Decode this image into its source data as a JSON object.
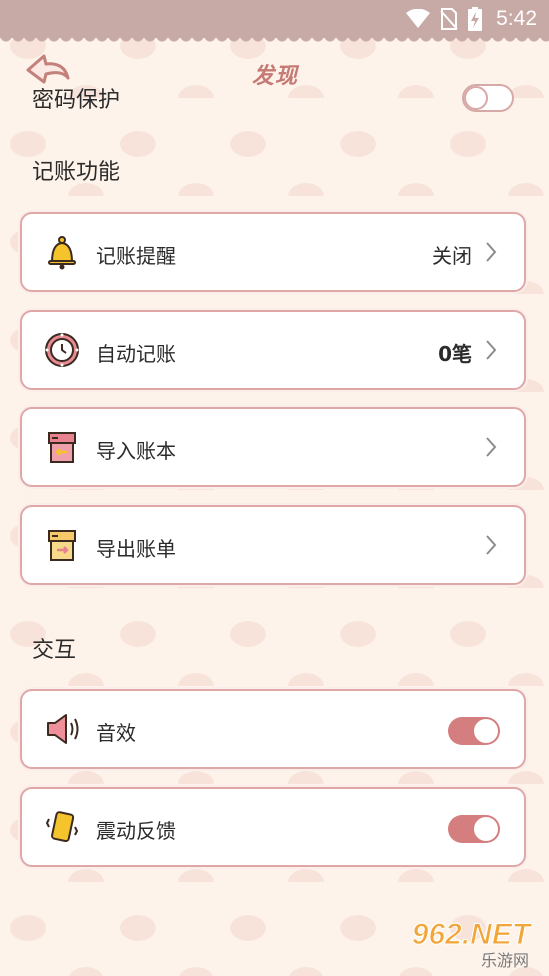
{
  "status_bar": {
    "time": "5:42",
    "icons": [
      "wifi-icon",
      "no-sim-icon",
      "battery-charging-icon"
    ],
    "background_color": "#c7a9a6"
  },
  "header": {
    "title": "发现",
    "back_icon": "back-arrow-icon",
    "title_color": "#c67a74"
  },
  "password_row": {
    "label": "密码保护",
    "enabled": false
  },
  "accounting": {
    "section_title": "记账功能",
    "items": [
      {
        "icon": "bell-icon",
        "label": "记账提醒",
        "value": "关闭",
        "bold": false
      },
      {
        "icon": "clock-icon",
        "label": "自动记账",
        "value": "0笔",
        "bold": true
      },
      {
        "icon": "import-box-icon",
        "label": "导入账本",
        "value": "",
        "bold": false
      },
      {
        "icon": "export-box-icon",
        "label": "导出账单",
        "value": "",
        "bold": false
      }
    ]
  },
  "interaction": {
    "section_title": "交互",
    "items": [
      {
        "icon": "speaker-icon",
        "label": "音效",
        "enabled": true
      },
      {
        "icon": "phone-vibrate-icon",
        "label": "震动反馈",
        "enabled": true
      }
    ]
  },
  "watermark": {
    "text": "962.NET",
    "subtext": "乐游网"
  },
  "colors": {
    "accent": "#d47e80",
    "card_border": "#dfa8a7",
    "background": "#fdf3ea"
  }
}
